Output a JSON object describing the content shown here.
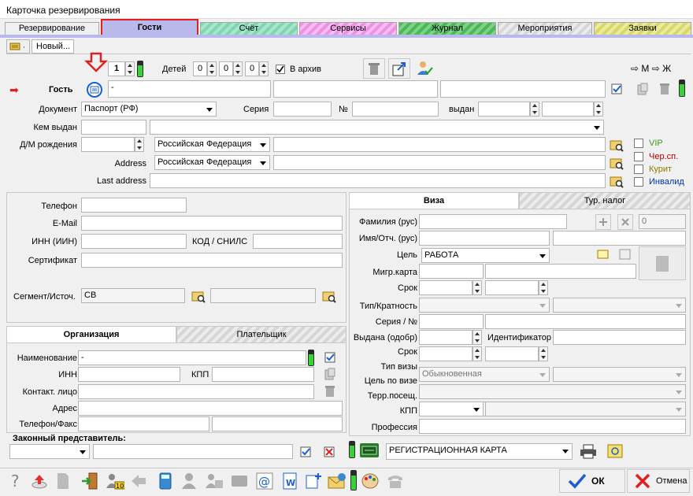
{
  "window": {
    "title": "Карточка резервирования"
  },
  "tabs": [
    {
      "label": "Резервирование"
    },
    {
      "label": "Гости"
    },
    {
      "label": "Счёт"
    },
    {
      "label": "Сервисы"
    },
    {
      "label": "Журнал"
    },
    {
      "label": "Мероприятия"
    },
    {
      "label": "Заявки"
    }
  ],
  "subtab": {
    "label": "Новый..."
  },
  "guest_top": {
    "adults_value": "1",
    "children_label": "Детей",
    "children_values": [
      "0",
      "0",
      "0"
    ],
    "archive_label": "В архив",
    "archive_checked": true,
    "gender_m": "М",
    "gender_f": "Ж"
  },
  "guest": {
    "label": "Гость",
    "name_value": "-",
    "document_label": "Документ",
    "document_value": "Паспорт  (РФ)",
    "series_label": "Серия",
    "number_label": "№",
    "issued_label": "выдан",
    "issued_by_label": "Кем выдан",
    "birth_label": "Д/М рождения",
    "birth_country": "Российская Федерация",
    "address_label": "Address",
    "address_country": "Российская Федерация",
    "last_address_label": "Last address",
    "flags": [
      {
        "label": "VIP",
        "color": "#3a9a1a"
      },
      {
        "label": "Чер.сп.",
        "color": "#b00000"
      },
      {
        "label": "Курит",
        "color": "#8a7a00"
      },
      {
        "label": "Инвалид",
        "color": "#0030b0"
      }
    ]
  },
  "contacts": {
    "phone_label": "Телефон",
    "email_label": "E-Mail",
    "inn_label": "ИНН (ИИН)",
    "snils_label": "КОД / СНИЛС",
    "cert_label": "Сертификат",
    "segment_label": "Сегмент/Источ.",
    "segment_value": "СВ"
  },
  "org_tabs": [
    {
      "label": "Организация"
    },
    {
      "label": "Плательщик"
    }
  ],
  "org": {
    "name_label": "Наименование",
    "name_value": "-",
    "inn_label": "ИНН",
    "kpp_label": "КПП",
    "contact_label": "Контакт. лицо",
    "address_label": "Адрес",
    "phonefax_label": "Телефон/Факс"
  },
  "legal_rep": {
    "label": "Законный представитель:"
  },
  "visa_tabs": [
    {
      "label": "Виза"
    },
    {
      "label": "Тур. налог"
    }
  ],
  "visa": {
    "surname_label": "Фамилия (рус)",
    "name_label": "Имя/Отч. (рус)",
    "count_value": "0",
    "purpose_label": "Цель",
    "purpose_value": "РАБОТА",
    "migr_label": "Мигр.карта",
    "term_label": "Срок",
    "type_label": "Тип/Кратность",
    "series_label": "Серия / №",
    "issued_label": "Выдана (одобр)",
    "identifier_label": "Идентификатор",
    "term2_label": "Срок",
    "visa_type_label": "Тип визы",
    "visa_type_value": "Обыкновенная",
    "visa_purpose_label": "Цель по визе",
    "terr_label": "Терр.посещ.",
    "kpp_label": "КПП",
    "profession_label": "Профессия"
  },
  "print": {
    "form_value": "РЕГИСТРАЦИОННАЯ КАРТА"
  },
  "footer": {
    "ok_label": "ОК",
    "cancel_label": "Отмена"
  }
}
